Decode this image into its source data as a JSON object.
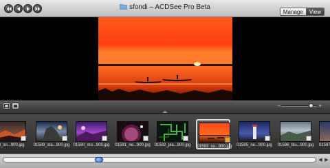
{
  "window": {
    "title": "sfondi – ACDSee Pro Beta",
    "nav": [
      "rewind-icon",
      "back-icon",
      "forward-icon",
      "fast-forward-icon"
    ]
  },
  "modes": {
    "manage": "Manage",
    "view": "View",
    "active": "View"
  },
  "viewer": {
    "image_name": "01593_su...900.jpg"
  },
  "zoom": {
    "level": 0.9
  },
  "filmstrip": {
    "items": [
      {
        "name": "68_sn...900.jpg",
        "selected": false
      },
      {
        "name": "01589_sta...900.jpg",
        "selected": false
      },
      {
        "name": "01590_mo...900.jpg",
        "selected": false
      },
      {
        "name": "01591_ne...900.jpg",
        "selected": false
      },
      {
        "name": "01592_pla...900.jpg",
        "selected": false
      },
      {
        "name": "01593_su...900.jpg",
        "selected": true
      },
      {
        "name": "01595_ne...900.jpg",
        "selected": false
      },
      {
        "name": "01596_blu...900.jpg",
        "selected": false
      },
      {
        "name": "01597",
        "selected": false
      }
    ]
  },
  "scroll": {
    "position": 0.3
  },
  "colors": {
    "accent": "#2f63c9",
    "selected_check": "#f0a020"
  }
}
